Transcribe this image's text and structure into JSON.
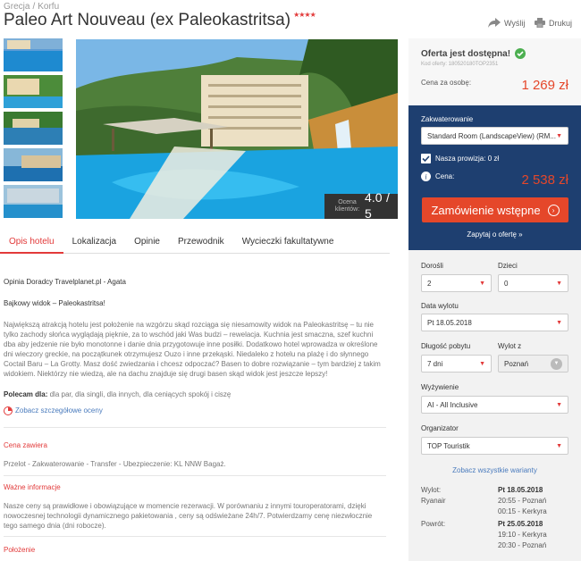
{
  "breadcrumb": {
    "country": "Grecja",
    "sep": "/",
    "region": "Korfu"
  },
  "hotel": {
    "name": "Paleo Art Nouveau (ex Paleokastritsa)",
    "stars": "★★★★"
  },
  "actions": {
    "send": "Wyślij",
    "print": "Drukuj"
  },
  "rating": {
    "label": "Ocena klientów:",
    "value": "4.0",
    "max": "/ 5"
  },
  "tabs": [
    "Opis hotelu",
    "Lokalizacja",
    "Opinie",
    "Przewodnik",
    "Wycieczki fakultatywne"
  ],
  "description": {
    "advisor": "Opinia Doradcy Travelplanet.pl - Agata",
    "headline": "Bajkowy widok – Paleokastritsa!",
    "body": "Największą atrakcją hotelu jest położenie na wzgórzu skąd rozciąga się niesamowity widok na Paleokastritsę – tu nie tylko zachody słońca wyglądają pięknie, za to wschód jaki Was budzi – rewelacja. Kuchnia jest smaczna, szef kuchni dba aby jedzenie nie było monotonne i danie dnia przygotowuje inne posiłki. Dodatkowo hotel wprowadza w określone dni wieczory greckie, na początkunek otrzymujesz Ouzo i inne przekąski. Niedaleko z hotelu na plażę i do słynnego Coctail Baru – La Grotty. Masz dość zwiedzania i chcesz odpoczać? Basen to dobre rozwiązanie – tym bardziej z takim widokiem. Niektórzy nie wiedzą, ale na dachu znajduje się drugi basen skąd widok jest jeszcze lepszy!",
    "recommended_label": "Polecam dla:",
    "recommended_text": "dla par, dla singli, dla innych, dla ceniących spokój i ciszę",
    "details_link": "Zobacz szczegółowe oceny"
  },
  "price_includes": {
    "title": "Cena zawiera",
    "text": "Przelot - Zakwaterowanie - Transfer - Ubezpieczenie: KL NNW Bagaż."
  },
  "important": {
    "title": "Ważne informacje",
    "text": "Nasze ceny są prawidłowe i obowiązujące w momencie rezerwacji. W porównaniu z innymi touroperatorami, dzięki nowoczesnej technologii dynamicznego pakietowania , ceny są odświeżane 24h/7. Potwierdzamy cenę niezwłocznie tego samego dnia (dni robocze)."
  },
  "location": {
    "title": "Położenie"
  },
  "offer": {
    "status": "Oferta jest dostępna!",
    "offer_no": "Kod oferty: 180520180TOP2351",
    "per_person_label": "Cena za osobę:",
    "per_person_price": "1 269 zł",
    "accommodation_label": "Zakwaterowanie",
    "accommodation_value": "Standard Room (LandscapeView) (RM...",
    "commission_label": "Nasza prowizja: 0 zł",
    "total_label": "Cena:",
    "total_price": "2 538 zł",
    "order_button": "Zamówienie wstępne",
    "ask_link": "Zapytaj o ofertę »"
  },
  "form": {
    "adults_label": "Dorośli",
    "adults_value": "2",
    "children_label": "Dzieci",
    "children_value": "0",
    "departure_label": "Data wylotu",
    "departure_value": "Pt 18.05.2018",
    "duration_label": "Długość pobytu",
    "duration_value": "7 dni",
    "from_label": "Wylot z",
    "from_value": "Poznań",
    "board_label": "Wyżywienie",
    "board_value": "AI - All Inclusive",
    "organizer_label": "Organizator",
    "organizer_value": "TOP Touristik",
    "variants_link": "Zobacz wszystkie warianty"
  },
  "flights": {
    "out_label": "Wylot:",
    "airline": "Ryanair",
    "out_date": "Pt 18.05.2018",
    "out_dep": "20:55 - Poznań",
    "out_arr": "00:15 - Kerkyra",
    "ret_label": "Powrót:",
    "ret_date": "Pt 25.05.2018",
    "ret_dep": "19:10 - Kerkyra",
    "ret_arr": "20:30 - Poznań"
  },
  "colors": {
    "accent": "#e23a3a",
    "navy": "#1e3f70",
    "order": "#e5472a",
    "success": "#4caf50"
  }
}
